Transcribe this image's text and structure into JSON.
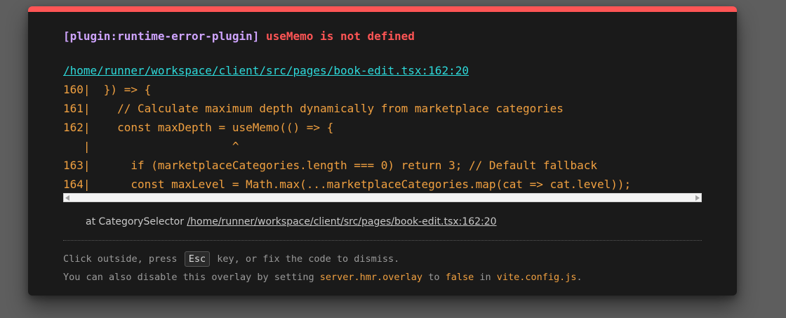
{
  "error": {
    "plugin": "[plugin:runtime-error-plugin]",
    "message": "useMemo is not defined"
  },
  "file_link": "/home/runner/workspace/client/src/pages/book-edit.tsx:162:20",
  "frame_lines": [
    "160|  }) => {",
    "161|    // Calculate maximum depth dynamically from marketplace categories",
    "162|    const maxDepth = useMemo(() => {",
    "   |                     ^",
    "163|      if (marketplaceCategories.length === 0) return 3; // Default fallback",
    "164|      const maxLevel = Math.max(...marketplaceCategories.map(cat => cat.level));"
  ],
  "stack": {
    "prefix": "at CategorySelector ",
    "link": "/home/runner/workspace/client/src/pages/book-edit.tsx:162:20"
  },
  "tips": {
    "line1_before": "Click outside, press ",
    "line1_key": "Esc",
    "line1_after": " key, or fix the code to dismiss.",
    "line2_before": "You can also disable this overlay by setting ",
    "line2_setting": "server.hmr.overlay",
    "line2_to": " to ",
    "line2_value": "false",
    "line2_in": " in ",
    "line2_file": "vite.config.js",
    "line2_end": "."
  },
  "colors": {
    "accent_bar": "#ff5555",
    "plugin_text": "#cfa4ff",
    "error_text": "#ff5555",
    "link": "#2dd9da",
    "code": "#f0a040",
    "background": "#1a1a1a"
  }
}
